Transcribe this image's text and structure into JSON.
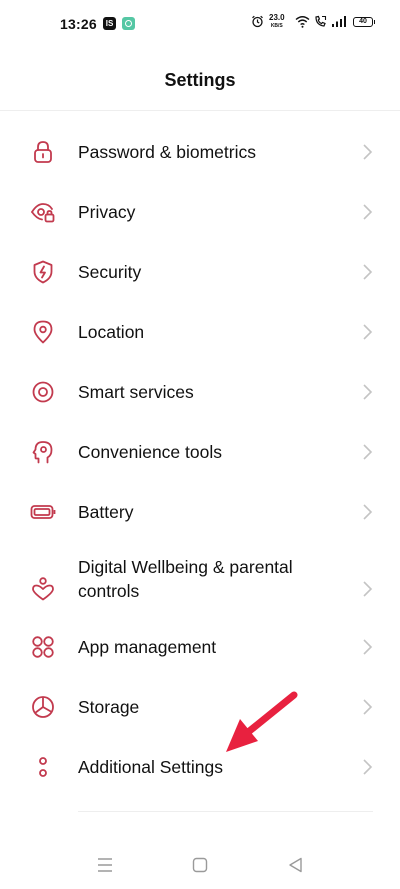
{
  "status_bar": {
    "time": "13:26",
    "notif_badge": "IS",
    "speed_value": "23.0",
    "speed_unit": "KB/S",
    "battery": "40",
    "icons": [
      "alarm-icon",
      "wifi-icon",
      "call-icon",
      "signal-icon",
      "battery-icon"
    ]
  },
  "header": {
    "title": "Settings"
  },
  "colors": {
    "accent": "#c23a4e",
    "arrow": "#e8213f",
    "chevron": "#c4c4c4"
  },
  "items": [
    {
      "label": "Password & biometrics",
      "icon": "lock-icon"
    },
    {
      "label": "Privacy",
      "icon": "privacy-eye-icon"
    },
    {
      "label": "Security",
      "icon": "shield-bolt-icon"
    },
    {
      "label": "Location",
      "icon": "location-pin-icon"
    },
    {
      "label": "Smart services",
      "icon": "target-circle-icon"
    },
    {
      "label": "Convenience tools",
      "icon": "head-gear-icon"
    },
    {
      "label": "Battery",
      "icon": "battery-icon"
    },
    {
      "label": "Digital Wellbeing & parental controls",
      "label_line1": "Digital Wellbeing & parental",
      "label_line2": "controls",
      "icon": "heart-person-icon"
    },
    {
      "label": "App management",
      "icon": "app-grid-icon"
    },
    {
      "label": "Storage",
      "icon": "pie-chart-icon"
    },
    {
      "label": "Additional Settings",
      "icon": "two-dots-icon"
    }
  ],
  "nav": [
    "menu-icon",
    "home-icon",
    "back-icon"
  ]
}
